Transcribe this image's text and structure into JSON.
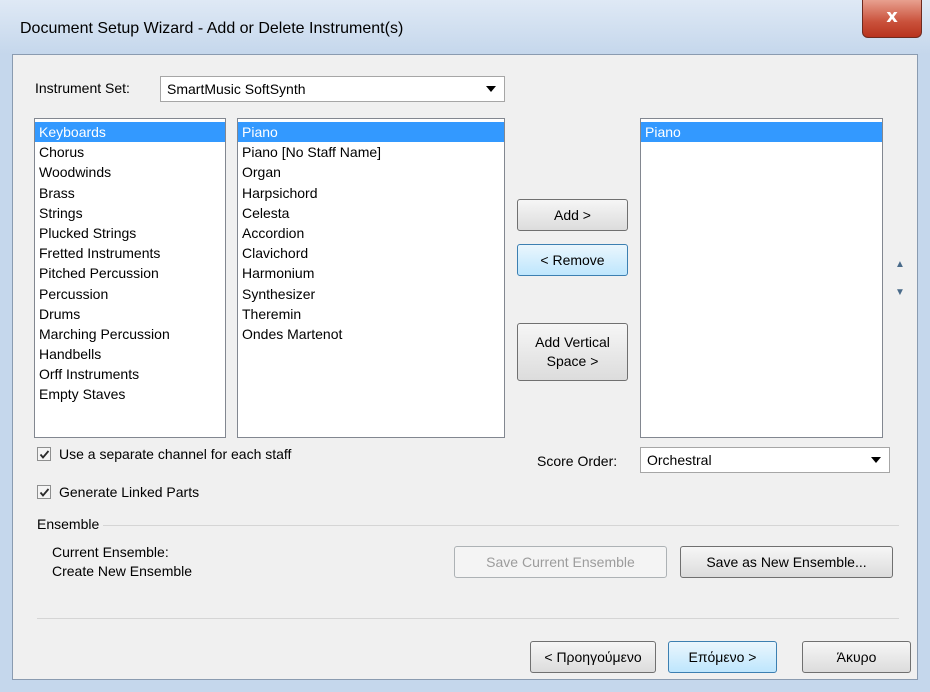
{
  "window": {
    "title": "Document Setup Wizard - Add or Delete Instrument(s)",
    "close_glyph": "x"
  },
  "instrument_set": {
    "label": "Instrument Set:",
    "value": "SmartMusic SoftSynth"
  },
  "categories": [
    {
      "label": "Keyboards",
      "selected": true
    },
    {
      "label": "Chorus"
    },
    {
      "label": "Woodwinds"
    },
    {
      "label": "Brass"
    },
    {
      "label": "Strings"
    },
    {
      "label": "Plucked Strings"
    },
    {
      "label": "Fretted Instruments"
    },
    {
      "label": "Pitched Percussion"
    },
    {
      "label": "Percussion"
    },
    {
      "label": "Drums"
    },
    {
      "label": "Marching Percussion"
    },
    {
      "label": "Handbells"
    },
    {
      "label": "Orff Instruments"
    },
    {
      "label": "Empty Staves"
    }
  ],
  "instruments": [
    {
      "label": "Piano",
      "selected": true
    },
    {
      "label": "Piano [No Staff Name]"
    },
    {
      "label": "Organ"
    },
    {
      "label": "Harpsichord"
    },
    {
      "label": "Celesta"
    },
    {
      "label": "Accordion"
    },
    {
      "label": "Clavichord"
    },
    {
      "label": "Harmonium"
    },
    {
      "label": "Synthesizer"
    },
    {
      "label": "Theremin"
    },
    {
      "label": "Ondes Martenot"
    }
  ],
  "selected_instruments": [
    {
      "label": "Piano",
      "selected": true
    }
  ],
  "buttons": {
    "add": "Add >",
    "remove": "< Remove",
    "add_vertical_line1": "Add Vertical",
    "add_vertical_line2": "Space >",
    "move_up": "▲",
    "move_down": "▼",
    "save_current": "Save Current Ensemble",
    "save_new": "Save as New Ensemble...",
    "back": "< Προηγούμενο",
    "next": "Επόμενο >",
    "cancel": "Άκυρο"
  },
  "options": {
    "separate_channel": {
      "label": "Use a separate channel for each staff",
      "checked": true
    },
    "linked_parts": {
      "label": "Generate Linked Parts",
      "checked": true
    }
  },
  "score_order": {
    "label": "Score Order:",
    "value": "Orchestral"
  },
  "ensemble": {
    "heading": "Ensemble",
    "current_label": "Current Ensemble:",
    "current_value": "Create New Ensemble"
  }
}
